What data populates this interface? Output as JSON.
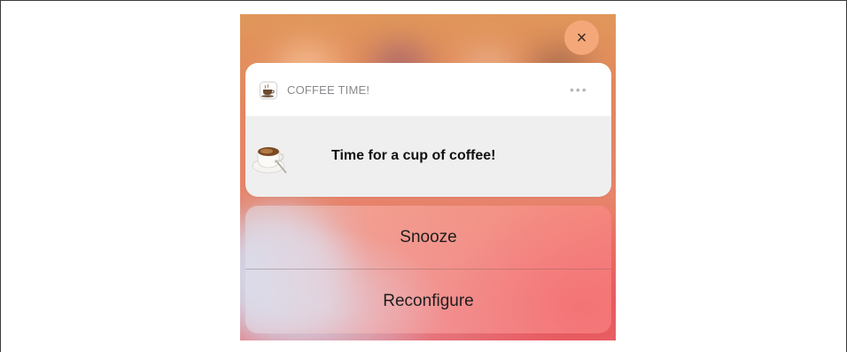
{
  "notification": {
    "app_name": "COFFEE TIME!",
    "app_icon": "coffee-cup-icon",
    "more_icon": "ellipsis-icon",
    "more_label": "•••",
    "close_icon": "close-icon",
    "close_label": "×",
    "attachment_icon": "coffee-cup-photo",
    "message": "Time for a cup of coffee!"
  },
  "actions": [
    {
      "label": "Snooze"
    },
    {
      "label": "Reconfigure"
    }
  ],
  "colors": {
    "close_button": "#f4a87a",
    "card_header": "#ffffff",
    "card_body": "#efefef"
  }
}
